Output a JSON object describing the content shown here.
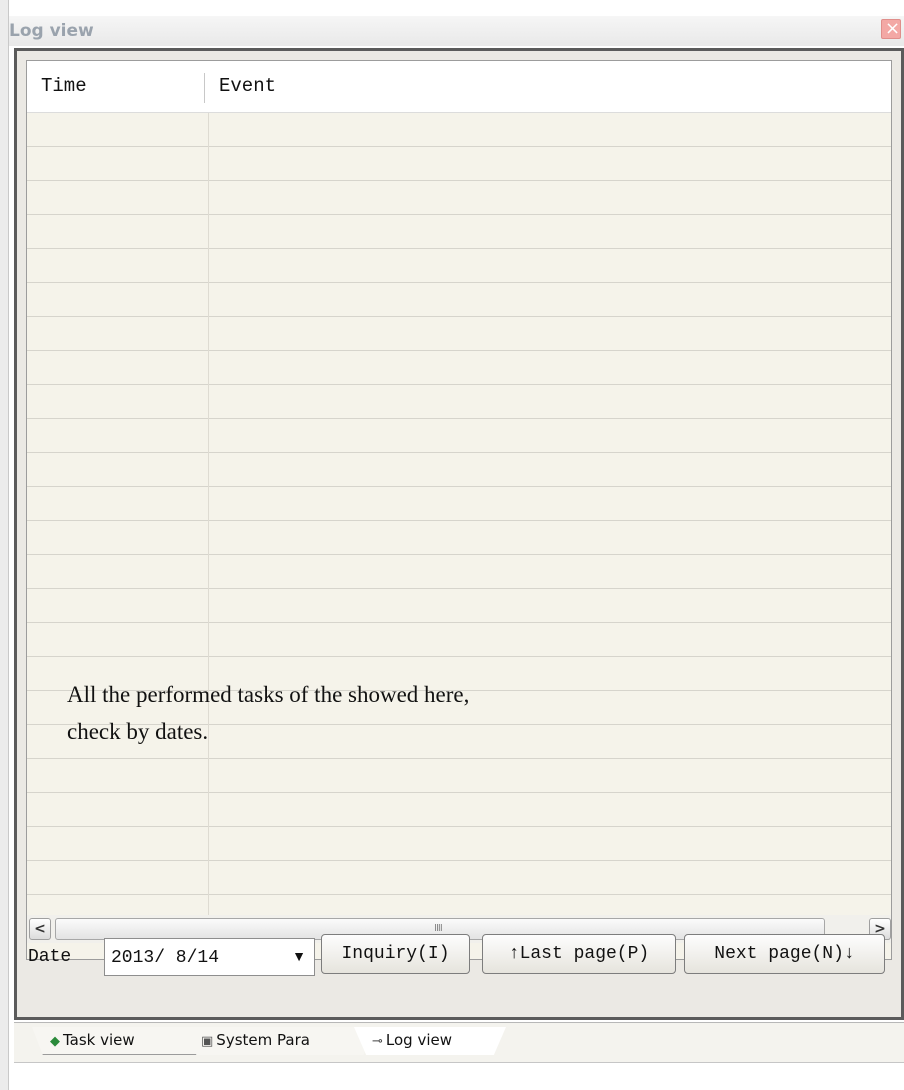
{
  "window": {
    "title": "Log view",
    "close_icon": "close-icon"
  },
  "table": {
    "columns": [
      "Time",
      "Event"
    ],
    "rows": []
  },
  "note": {
    "line1": "All the performed tasks of the showed here,",
    "line2": "check by dates."
  },
  "scrollbar": {
    "left_glyph": "<",
    "right_glyph": ">",
    "grip": "IIII"
  },
  "toolbar": {
    "date_label": "Date",
    "date_value": "2013/ 8/14",
    "dropdown_glyph": "▼",
    "inquiry_label": "Inquiry(I)",
    "last_page_label": "↑Last page(P)",
    "next_page_label": "Next page(N)↓"
  },
  "tabs": [
    {
      "label": "Task view",
      "icon": "task-icon"
    },
    {
      "label": "System Para",
      "icon": "system-icon"
    },
    {
      "label": "Log view",
      "icon": "log-icon",
      "active": true
    }
  ],
  "colors": {
    "grid_bg": "#f5f3ea",
    "title_text": "#9aa3ad",
    "close_bg": "#f3a8a5"
  }
}
